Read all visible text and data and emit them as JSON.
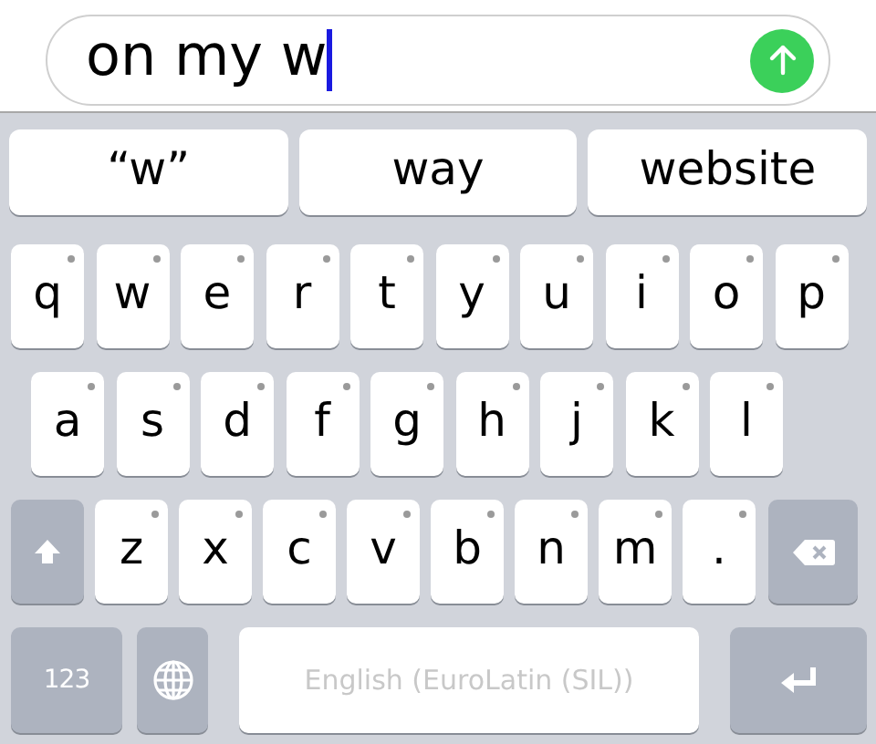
{
  "message_field": {
    "value": "on my w"
  },
  "suggestions": [
    {
      "label": "“w”"
    },
    {
      "label": "way"
    },
    {
      "label": "website"
    }
  ],
  "keyboard_rows": [
    {
      "keys": [
        {
          "kind": "letter",
          "label": "q"
        },
        {
          "kind": "letter",
          "label": "w"
        },
        {
          "kind": "letter",
          "label": "e"
        },
        {
          "kind": "letter",
          "label": "r"
        },
        {
          "kind": "letter",
          "label": "t"
        },
        {
          "kind": "letter",
          "label": "y"
        },
        {
          "kind": "letter",
          "label": "u"
        },
        {
          "kind": "letter",
          "label": "i"
        },
        {
          "kind": "letter",
          "label": "o"
        },
        {
          "kind": "letter",
          "label": "p"
        }
      ]
    },
    {
      "keys": [
        {
          "kind": "letter",
          "label": "a"
        },
        {
          "kind": "letter",
          "label": "s"
        },
        {
          "kind": "letter",
          "label": "d"
        },
        {
          "kind": "letter",
          "label": "f"
        },
        {
          "kind": "letter",
          "label": "g"
        },
        {
          "kind": "letter",
          "label": "h"
        },
        {
          "kind": "letter",
          "label": "j"
        },
        {
          "kind": "letter",
          "label": "k"
        },
        {
          "kind": "letter",
          "label": "l"
        }
      ]
    },
    {
      "keys": [
        {
          "kind": "shift"
        },
        {
          "kind": "letter",
          "label": "z"
        },
        {
          "kind": "letter",
          "label": "x"
        },
        {
          "kind": "letter",
          "label": "c"
        },
        {
          "kind": "letter",
          "label": "v"
        },
        {
          "kind": "letter",
          "label": "b"
        },
        {
          "kind": "letter",
          "label": "n"
        },
        {
          "kind": "letter",
          "label": "m"
        },
        {
          "kind": "letter",
          "label": "."
        },
        {
          "kind": "backspace"
        }
      ]
    },
    {
      "keys": [
        {
          "kind": "numbers",
          "label": "123"
        },
        {
          "kind": "globe"
        },
        {
          "kind": "space",
          "label": "English (EuroLatin (SIL))"
        },
        {
          "kind": "return"
        }
      ]
    }
  ]
}
